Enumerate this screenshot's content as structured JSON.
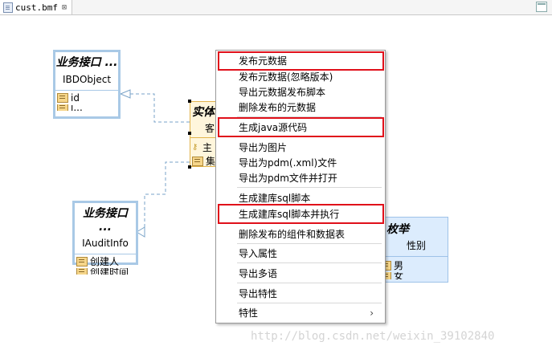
{
  "tab": {
    "title": "cust.bmf",
    "close": "⊠"
  },
  "nodes": {
    "ibdobject": {
      "stereotype": "业务接口 ...",
      "name": "IBDObject",
      "attr1": "id",
      "attr2": "i..."
    },
    "iauditinfo": {
      "stereotype": "业务接口 ...",
      "name": "IAuditInfo",
      "attr1": "创建人",
      "attr2": "创建时间"
    },
    "entity": {
      "stereotype": "实体",
      "name": "客",
      "attr1": "主",
      "attr2": "集"
    },
    "enum": {
      "stereotype": "枚举",
      "name": "性别",
      "attr1": "男",
      "attr2": "女"
    }
  },
  "menu": {
    "items": [
      "发布元数据",
      "发布元数据(忽略版本)",
      "导出元数据发布脚本",
      "删除发布的元数据",
      "生成java源代码",
      "导出为图片",
      "导出为pdm(.xml)文件",
      "导出为pdm文件并打开",
      "生成建库sql脚本",
      "生成建库sql脚本并执行",
      "删除发布的组件和数据表",
      "导入属性",
      "导出多语",
      "导出特性",
      "特性"
    ],
    "submenu_arrow": "›"
  },
  "watermark": "http://blog.csdn.net/weixin_39102840",
  "colors": {
    "highlight": "#e0101a",
    "box_border": "#a9c9e6",
    "entity_bg": "#fff6dc",
    "enum_bg": "#dcecfd"
  }
}
